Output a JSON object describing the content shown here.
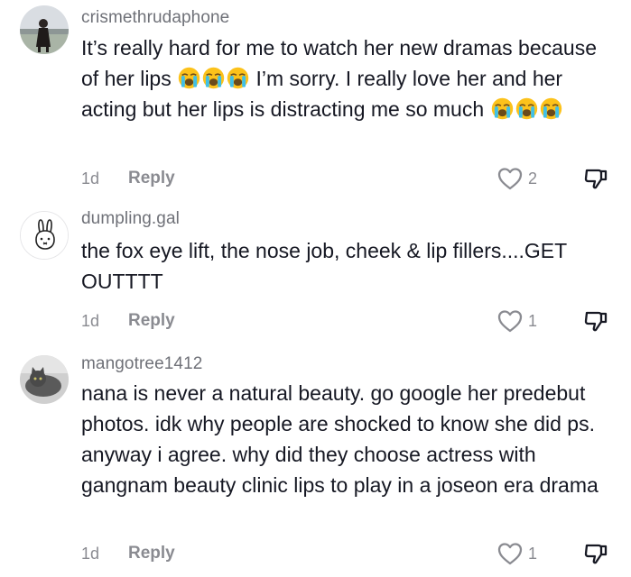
{
  "comments": [
    {
      "username": "crismethrudaphone",
      "text_parts": [
        "It’s really hard for me to watch her new dramas because of her lips",
        "I’m sorry. I really love her and her acting but her lips is distracting me so much"
      ],
      "time": "1d",
      "reply_label": "Reply",
      "likes": "2",
      "avatar": "person-photo-avatar"
    },
    {
      "username": "dumpling.gal",
      "text": "the fox eye lift, the nose job, cheek & lip fillers....GET OUTTTT",
      "time": "1d",
      "reply_label": "Reply",
      "likes": "1",
      "avatar": "bunny-drawing-avatar"
    },
    {
      "username": "mangotree1412",
      "text": "nana is never a natural beauty. go google her predebut photos. idk why people are shocked to know she did ps. anyway i agree. why did they choose actress with gangnam beauty clinic lips to play in a joseon era drama",
      "time": "1d",
      "reply_label": "Reply",
      "likes": "1",
      "avatar": "cat-photo-avatar"
    }
  ],
  "icons": {
    "emoji": "loudly-crying-face-emoji",
    "like": "heart-outline-icon",
    "dislike": "thumbs-down-icon"
  },
  "colors": {
    "text": "#161823",
    "muted": "#8a8b91",
    "username": "#6f7178",
    "emoji_face": "#fcc21b"
  }
}
